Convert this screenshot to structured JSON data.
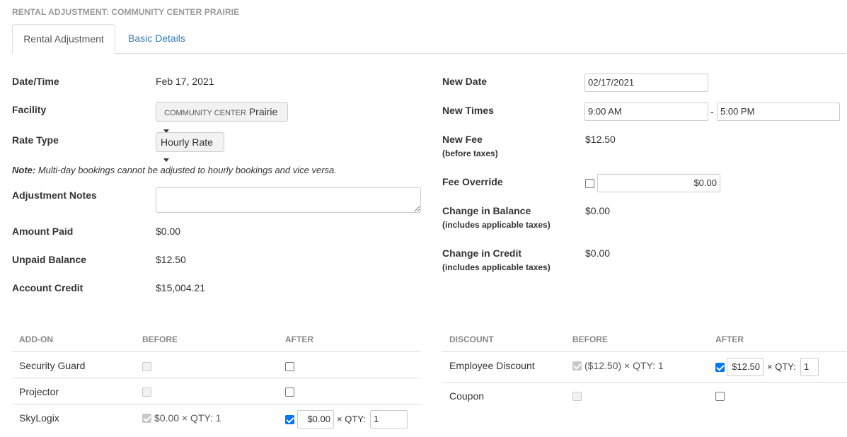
{
  "page_title": "RENTAL ADJUSTMENT: COMMUNITY CENTER PRAIRIE",
  "tabs": [
    {
      "label": "Rental Adjustment",
      "active": true
    },
    {
      "label": "Basic Details",
      "active": false
    }
  ],
  "left": {
    "date_time": {
      "label": "Date/Time",
      "value": "Feb 17, 2021"
    },
    "facility": {
      "label": "Facility",
      "small": "COMMUNITY CENTER",
      "value": "Prairie"
    },
    "rate_type": {
      "label": "Rate Type",
      "value": "Hourly Rate"
    },
    "note": {
      "prefix": "Note:",
      "text": "Multi-day bookings cannot be adjusted to hourly bookings and vice versa."
    },
    "adjustment_notes": {
      "label": "Adjustment Notes",
      "value": ""
    },
    "amount_paid": {
      "label": "Amount Paid",
      "value": "$0.00"
    },
    "unpaid_balance": {
      "label": "Unpaid Balance",
      "value": "$12.50"
    },
    "account_credit": {
      "label": "Account Credit",
      "value": "$15,004.21"
    }
  },
  "right": {
    "new_date": {
      "label": "New Date",
      "value": "02/17/2021"
    },
    "new_times": {
      "label": "New Times",
      "start": "9:00 AM",
      "separator": "-",
      "end": "5:00 PM"
    },
    "new_fee": {
      "label": "New Fee",
      "sub": "(before taxes)",
      "value": "$12.50"
    },
    "fee_override": {
      "label": "Fee Override",
      "checked": false,
      "value": "$0.00"
    },
    "change_balance": {
      "label": "Change in Balance",
      "sub": "(includes applicable taxes)",
      "value": "$0.00"
    },
    "change_credit": {
      "label": "Change in Credit",
      "sub": "(includes applicable taxes)",
      "value": "$0.00"
    }
  },
  "addons": {
    "headers": [
      "ADD-ON",
      "BEFORE",
      "AFTER"
    ],
    "rows": [
      {
        "name": "Security Guard",
        "before_checked": false,
        "before_text": "",
        "after_checked": false
      },
      {
        "name": "Projector",
        "before_checked": false,
        "before_text": "",
        "after_checked": false
      },
      {
        "name": "SkyLogix",
        "before_checked": true,
        "before_text": "$0.00 × QTY: 1",
        "after_checked": true,
        "after_price": "$0.00",
        "qty_label": "× QTY:",
        "after_qty": "1"
      }
    ]
  },
  "discounts": {
    "headers": [
      "DISCOUNT",
      "BEFORE",
      "AFTER"
    ],
    "rows": [
      {
        "name": "Employee Discount",
        "before_checked": true,
        "before_text": "($12.50) × QTY: 1",
        "after_checked": true,
        "after_price": "$12.50",
        "qty_label": "× QTY:",
        "after_qty": "1"
      },
      {
        "name": "Coupon",
        "before_checked": false,
        "before_text": "",
        "after_checked": false
      }
    ]
  }
}
